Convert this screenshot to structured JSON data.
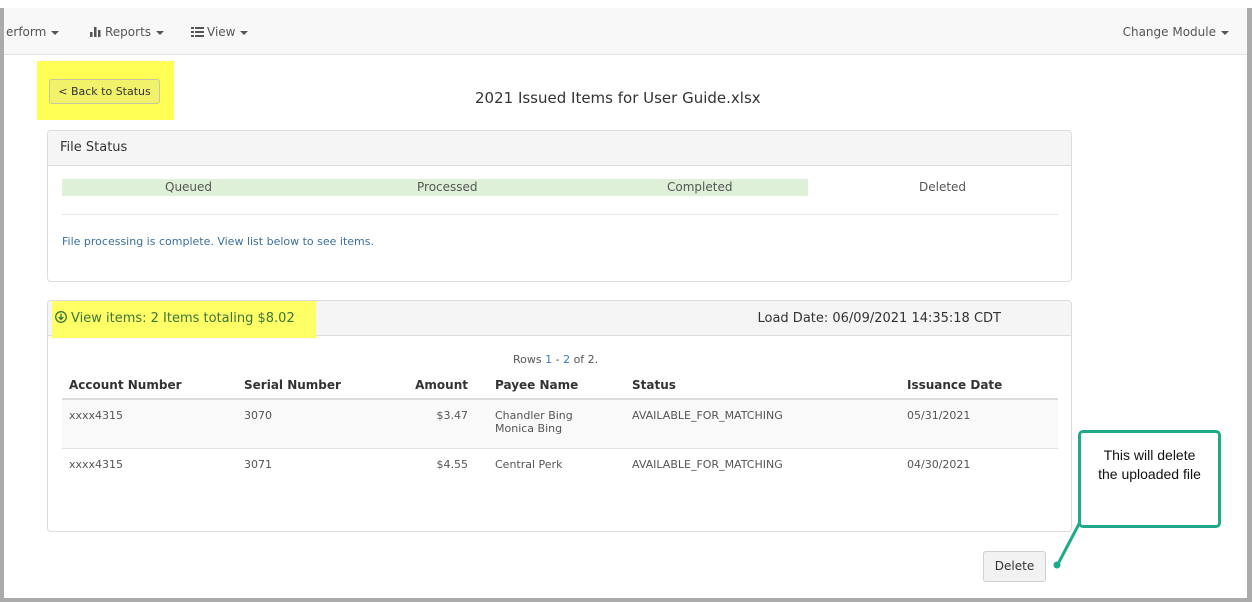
{
  "navbar": {
    "perform_label": "erform",
    "reports_label": "Reports",
    "view_label": "View",
    "change_module_label": "Change Module"
  },
  "header": {
    "back_button_label": "< Back to Status",
    "file_title": "2021 Issued Items for User Guide.xlsx"
  },
  "file_status": {
    "heading": "File Status",
    "stages": [
      "Queued",
      "Processed",
      "Completed",
      "Deleted"
    ],
    "completed_stages": 3,
    "message": "File processing is complete. View list below to see items."
  },
  "items_panel": {
    "view_items_label": "View items: 2 Items totaling $8.02",
    "load_date": "Load Date: 06/09/2021 14:35:18 CDT",
    "rows_prefix": "Rows ",
    "rows_from": "1",
    "rows_dash": " - ",
    "rows_to": "2",
    "rows_suffix": " of 2.",
    "columns": [
      "Account Number",
      "Serial Number",
      "Amount",
      "Payee Name",
      "Status",
      "Issuance Date"
    ],
    "rows": [
      {
        "account": "xxxx4315",
        "serial": "3070",
        "amount": "$3.47",
        "payee_line1": "Chandler Bing",
        "payee_line2": "Monica Bing",
        "status": "AVAILABLE_FOR_MATCHING",
        "date": "05/31/2021"
      },
      {
        "account": "xxxx4315",
        "serial": "3071",
        "amount": "$4.55",
        "payee_line1": "Central Perk",
        "payee_line2": "",
        "status": "AVAILABLE_FOR_MATCHING",
        "date": "04/30/2021"
      }
    ]
  },
  "delete_button_label": "Delete",
  "callout": {
    "line1": "This will delete",
    "line2": "the uploaded file"
  },
  "colors": {
    "highlight": "#ffff55",
    "progress_complete": "#dff0d8",
    "callout_border": "#1eaa8a",
    "link": "#3a7bbf"
  }
}
